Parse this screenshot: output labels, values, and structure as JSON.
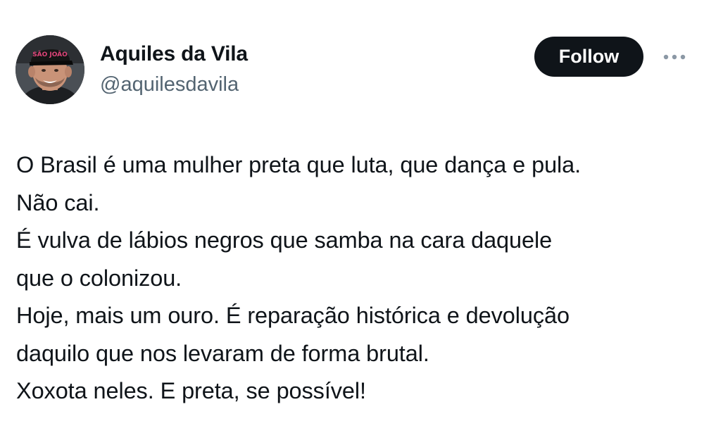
{
  "author": {
    "name": "Aquiles da Vila",
    "handle": "@aquilesdavila",
    "avatar_cap_text": "SÃO JOÃO"
  },
  "actions": {
    "follow_label": "Follow",
    "more_icon": "more-dots-icon"
  },
  "tweet": {
    "lines": [
      "O Brasil é uma mulher preta que luta, que dança e pula.",
      "Não cai.",
      "É vulva de lábios negros que samba na cara daquele",
      "que o colonizou.",
      "Hoje, mais um ouro. É reparação histórica e devolução",
      "daquilo que nos levaram de forma brutal.",
      "Xoxota neles. E preta, se possível!"
    ]
  },
  "colors": {
    "text_primary": "#0f1419",
    "text_secondary": "#536471",
    "follow_bg": "#0f1419",
    "follow_text": "#ffffff",
    "more_dots": "#8b98a5"
  }
}
